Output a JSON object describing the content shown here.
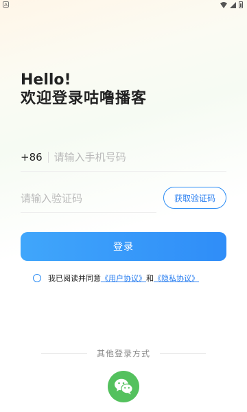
{
  "greeting": "Hello!",
  "subtitle": "欢迎登录咕噜播客",
  "phone": {
    "country_code": "+86",
    "placeholder": "请输入手机号码",
    "value": ""
  },
  "code": {
    "placeholder": "请输入验证码",
    "value": "",
    "get_code_label": "获取验证码"
  },
  "login_label": "登录",
  "agreement": {
    "prefix": "我已阅读并同意",
    "user_agreement": "《用户协议》",
    "conjunction": "和",
    "privacy_policy": "《隐私协议》",
    "checked": false
  },
  "other_login": {
    "label": "其他登录方式",
    "method_icon": "wechat-icon"
  },
  "colors": {
    "accent": "#2b8cf4",
    "wechat": "#54c15e"
  }
}
